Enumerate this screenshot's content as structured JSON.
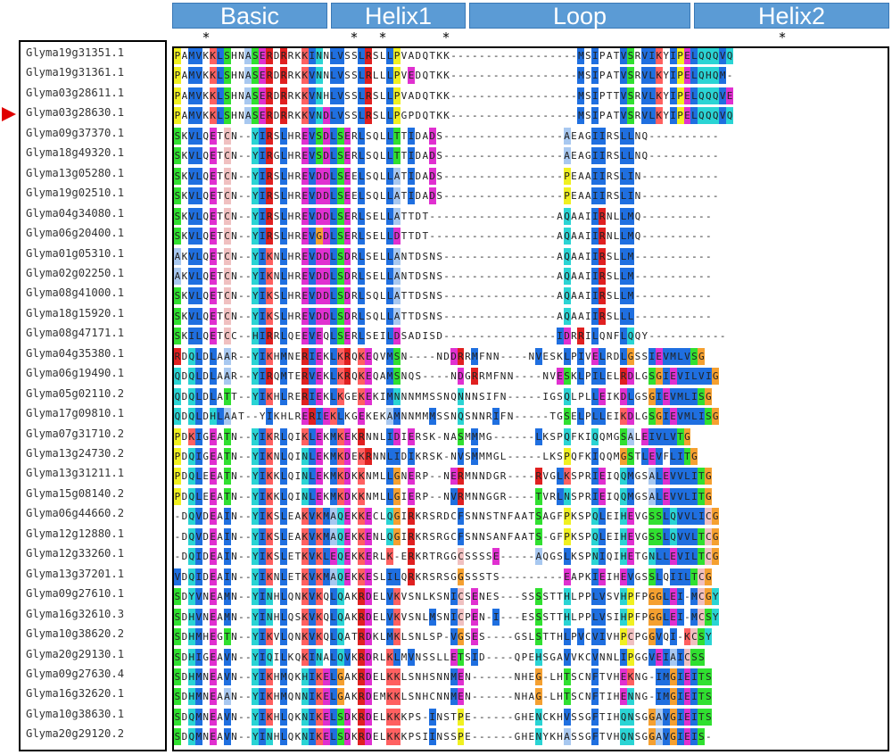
{
  "regions": [
    {
      "label": "Basic"
    },
    {
      "label": "Helix1"
    },
    {
      "label": "Loop"
    },
    {
      "label": "Helix2"
    }
  ],
  "conserved_markers": [
    "*",
    "*",
    "*",
    "*",
    "*"
  ],
  "highlighted_sequence": "Glyma03g28630.1",
  "colors": {
    "region_fill": "#5b9bd5",
    "marker_arrow": "#e00000"
  },
  "sequences": [
    {
      "id": "Glyma19g31351.1",
      "seq": "PAMVKKLSHNASERDRRKKINNLVSSLRSLLPVADQTKK------------------MSIPATVSRVIKYIPELQQQVQ"
    },
    {
      "id": "Glyma19g31361.1",
      "seq": "PAMVKKLSHNASERDRRKKVNNLVSSLRLLLPVEDQTKK------------------MSIPATVSRVLKYIPELQHQM-"
    },
    {
      "id": "Glyma03g28611.1",
      "seq": "PAMVKKLSHNASERDRRKKVNHLVSSLRSLLPVADQTKK------------------MSIPTTVSRVLKYIPELQQQVE"
    },
    {
      "id": "Glyma03g28630.1",
      "seq": "PAMVKKLSHNASERDRRKKVNDLVSSLRSLLPGPDQTKK------------------MSIPATVSRVLKYIPELQQQVQ"
    },
    {
      "id": "Glyma09g37370.1",
      "seq": "SKVLQETCN--YIRSLHREVSDLSERLSQLLTTIDADS-----------------AEAGIIRSLLNQ----------"
    },
    {
      "id": "Glyma18g49320.1",
      "seq": "SKVLQETCN--YIRGLHREVSDLSERLSQLLTTIDADS-----------------AEAGIIRSLLNQ----------"
    },
    {
      "id": "Glyma13g05280.1",
      "seq": "SKVLQETCN--YIRSLHREVDDLSEELSQLLATIDADS-----------------PEAAIIRSLIN-----------"
    },
    {
      "id": "Glyma19g02510.1",
      "seq": "SKVLQETCN--YIRSLHREVDDLSEELSQLLATIDADS-----------------PEAAIIRSLIN-----------"
    },
    {
      "id": "Glyma04g34080.1",
      "seq": "SKVLQETCN--YIRSLHREVDDLSERLSELLATTDT------------------AQAAIIRNLLMQ----------"
    },
    {
      "id": "Glyma06g20400.1",
      "seq": "SKVLQETCN--YIRSLHREVGDLSERLSELLDTTDT------------------AQAAIIRNLLMQ----------"
    },
    {
      "id": "Glyma01g05310.1",
      "seq": "AKVLQETCN--YIKNLHREVDDLSDRLSELLANTDSNS----------------AQAAIIRSLLM-----------"
    },
    {
      "id": "Glyma02g02250.1",
      "seq": "AKVLQETCN--YIKNLHREVDDLSDRLSELLANTDSNS----------------AQAAIIRSLLM-----------"
    },
    {
      "id": "Glyma08g41000.1",
      "seq": "SKVLQETCN--YIKSLHREVDDLSDRLSQLLATTDSNS----------------AQAAIIRSLLM-----------"
    },
    {
      "id": "Glyma18g15920.1",
      "seq": "SKVLQETCN--YIKSLHREVDDLSDRLSQLLATTDSNS----------------AQAAIIRSLLL-----------"
    },
    {
      "id": "Glyma08g47171.1",
      "seq": "SKILQETCC--HIRRLQEEVEQLSERLSEILDSADISD----------------IDRRILQNFLQQY-----------"
    },
    {
      "id": "Glyma04g35380.1",
      "seq": "RDQLDLAAR--YIKHMNERIEKLKRQKEQVMSN----NDDRRMFNN----NVESKLPIVELRDLGSSIEVMLVSG"
    },
    {
      "id": "Glyma06g19490.1",
      "seq": "QDQLDLAAR--YIRQMTERVEKLKRQKEQAMSNQS----NDGRRMFNN----NVESKLPILELRDLGSGIEVILVIG"
    },
    {
      "id": "Glyma05g02110.2",
      "seq": "QDQLDLATT--YIKHLRERIEKLKGEKEKIMNNNMMSSNQNNNSIFN-----IGSQLPLLEIKDLGSGIEVMLISG"
    },
    {
      "id": "Glyma17g09810.1",
      "seq": "QDQLDHLAAT--YIKHLRERIEKLKGEKEKAMNNMMMSSNQSNNRIFN-----TGSELPLLEIKDLGSGIEVMLISG"
    },
    {
      "id": "Glyma07g31710.2",
      "seq": "PDKIGEATN--YIKRLQIKLEKMKEKRNNLIDIERSK-NASMMMG------LKSPQFKIQQMGSALEIVLVTG"
    },
    {
      "id": "Glyma13g24730.2",
      "seq": "PDQIGEATN--YIKNLQINLEKMKDEKRNNLIDIKRSK-NVSMMMGL-----LKSPQFKIQQMGSTLEVFLITG"
    },
    {
      "id": "Glyma13g31211.1",
      "seq": "PDQLEEATN--YIKKLQINLEKMKDKKNMLLGNERP--NERMNNDGR----RVGLKSPRIEIQQMGSALEVVLITG"
    },
    {
      "id": "Glyma15g08140.2",
      "seq": "PDQLEEATN--YIKKLQINLEKMKDKKNMLLGIERP--NVRMNNGGR----TVRLNSPRIEIQQMGSALEVVLITG"
    },
    {
      "id": "Glyma06g44660.2",
      "seq": "-DQVDEAIN--YIKSLEAKVKMAQEKKECLQGIRKRSRDCFSNNSTNFAATSAGFPKSPQLEIHEVGSSLQVVLICG"
    },
    {
      "id": "Glyma12g12880.1",
      "seq": "-DQVDEAIN--YIKSLEAKVKMAQEKKENLQGIRKRSRGCFSNNSANFAATS-GFPKSPQLEIHEVGSSLQVVLTCG"
    },
    {
      "id": "Glyma12g33260.1",
      "seq": "-DQIDEAIN--YIKSLETKVKLEQEKKERLK-ERKRTRGGCSSSSE-----AQGSLKSPNIQIHETGNLLEVILTCG"
    },
    {
      "id": "Glyma13g37201.1",
      "seq": "VDQIDEAIN--YIKNLETKVKMAQEKKESLILQRKRSRSGGSSSTS---------EAPKIEIHEVGSSLQIILTCG"
    },
    {
      "id": "Glyma09g27610.1",
      "seq": "SDYVNEAMN--YINHLQNKVKQLQAKRDELVKVSNLKSNICSENES---SSSSTTHLPPLVSVHPFPGGLEI-MCGY"
    },
    {
      "id": "Glyma16g32610.3",
      "seq": "SDHVNEAMN--YINHLQSKVKQLQAKRDELVKVSNLMSNICPEN-I---ESSSTTHLPPLVSIHPFPGGLEI-MCSY"
    },
    {
      "id": "Glyma10g38620.2",
      "seq": "SDHMHEGTN--YIKVLQNKVKQLQATRDKLMKLSNLSP-VGSES----GSLSTTHLPVCVIVHPCPGGVQI-KCSY"
    },
    {
      "id": "Glyma20g29130.1",
      "seq": "SDHIGEAVN--YIQILKQKINALQVKRDRLKLMVNSSLLETSID----QPEHSGAVVKCVNNLIPGGVEIAICSS"
    },
    {
      "id": "Glyma09g27630.4",
      "seq": "SDHMNEAVN--YIKHMQKHIKELGAKRDELKKLSNHSNNMEN------NHEG-LHTSCNFTVHEKNG-IMGIEITS"
    },
    {
      "id": "Glyma16g32620.1",
      "seq": "SDHMNEAAN--YIKHMQNNIKELGAKRDEMKKLSNHCNNMEN------NHAG-LHTSCNFTIHENNG-IMGIEITS"
    },
    {
      "id": "Glyma10g38630.1",
      "seq": "SDQMNEAVN--YIKHLQKNIKELSDKRDELKKKPS-INSTPE------GHENCKHVSSGFTIHQNSGGAVGIEITS"
    },
    {
      "id": "Glyma20g29120.2",
      "seq": "SDQMNEAVN--YINHLQKNIKELSDKRDELKKKPSIINSSPE------GHENYKHASSGFTVHQNSGGAVGIEIS-"
    }
  ]
}
